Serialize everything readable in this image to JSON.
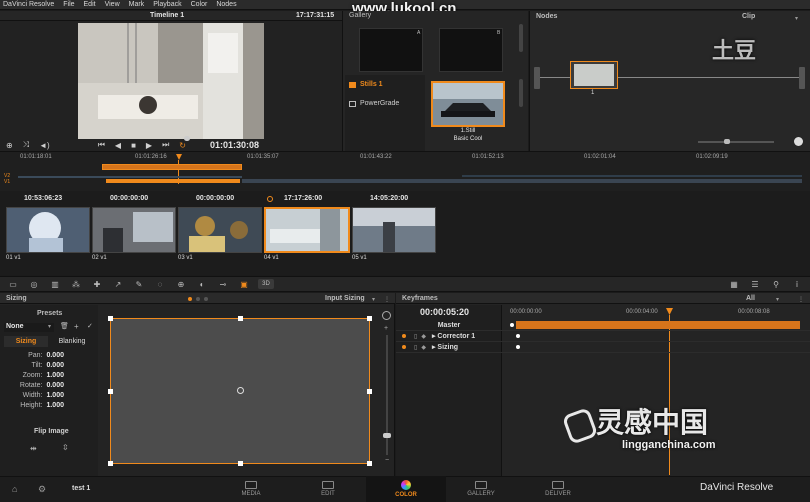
{
  "menu": {
    "items": [
      "DaVinci Resolve",
      "File",
      "Edit",
      "View",
      "Mark",
      "Playback",
      "Color",
      "Nodes"
    ]
  },
  "watermarks": {
    "top": "www.lukool.cn",
    "brand": "土豆",
    "bottom_cn": "灵感中国",
    "bottom_url": "lingganchina.com"
  },
  "viewer": {
    "timeline_title": "Timeline 1",
    "top_timecode": "17:17:31:15",
    "current_timecode": "01:01:30:08"
  },
  "gallery": {
    "title": "Gallery",
    "slot_a": "A",
    "slot_b": "B",
    "sidebar": [
      {
        "label": "Stills 1",
        "active": true
      },
      {
        "label": "PowerGrade",
        "active": false
      }
    ],
    "still": {
      "label": "1.Still",
      "sublabel": "Basic Cool"
    }
  },
  "nodes": {
    "title": "Nodes",
    "mode": "Clip",
    "node_label": "1"
  },
  "ruler": {
    "times": [
      "01:01:18:01",
      "01:01:26:16",
      "01:01:35:07",
      "01:01:43:22",
      "01:01:52:13",
      "01:02:01:04",
      "01:02:09:19"
    ]
  },
  "tracks": {
    "v2": "V2",
    "v1": "V1"
  },
  "clips": [
    {
      "timecode": "10:53:06:23",
      "label": "01",
      "track": "v1",
      "selected": false,
      "palette": [
        "#9fb6d2",
        "#dfe7f1",
        "#4a5a6e"
      ]
    },
    {
      "timecode": "00:00:00:00",
      "label": "02",
      "track": "v1",
      "selected": false,
      "palette": [
        "#6b6e73",
        "#b8c0c8",
        "#2d2f33"
      ]
    },
    {
      "timecode": "00:00:00:00",
      "label": "03",
      "track": "v1",
      "selected": false,
      "palette": [
        "#b08a42",
        "#3f4a55",
        "#d9c27a"
      ]
    },
    {
      "timecode": "17:17:26:00",
      "label": "04",
      "track": "v1",
      "selected": true,
      "palette": [
        "#c7cfd3",
        "#8d969c",
        "#e8eced"
      ]
    },
    {
      "timecode": "14:05:20:00",
      "label": "05",
      "track": "v1",
      "selected": false,
      "palette": [
        "#6f7b88",
        "#c9cfd6",
        "#3b3f45"
      ]
    }
  ],
  "toolbar": {
    "badge_3d": "3D"
  },
  "sizing": {
    "title": "Sizing",
    "dropdown": "Input Sizing",
    "presets_label": "Presets",
    "preset_value": "None",
    "tab_sizing": "Sizing",
    "tab_blanking": "Blanking",
    "params": [
      {
        "label": "Pan:",
        "value": "0.000"
      },
      {
        "label": "Tilt:",
        "value": "0.000"
      },
      {
        "label": "Zoom:",
        "value": "1.000"
      },
      {
        "label": "Rotate:",
        "value": "0.000"
      },
      {
        "label": "Width:",
        "value": "1.000"
      },
      {
        "label": "Height:",
        "value": "1.000"
      }
    ],
    "flip_label": "Flip Image"
  },
  "keyframes": {
    "title": "Keyframes",
    "filter": "All",
    "timecode": "00:00:05:20",
    "ruler": [
      "00:00:00:00",
      "00:00:04:00",
      "00:00:08:08"
    ],
    "rows": [
      "Master",
      "Corrector 1",
      "Sizing"
    ]
  },
  "footer": {
    "project": "test 1",
    "pages": [
      {
        "label": "MEDIA",
        "active": false
      },
      {
        "label": "EDIT",
        "active": false
      },
      {
        "label": "COLOR",
        "active": true
      },
      {
        "label": "GALLERY",
        "active": false
      },
      {
        "label": "DELIVER",
        "active": false
      }
    ],
    "app_name": "DaVinci Resolve"
  },
  "colors": {
    "accent": "#f08a1c",
    "bg": "#1b1b1b",
    "panel": "#232323"
  }
}
